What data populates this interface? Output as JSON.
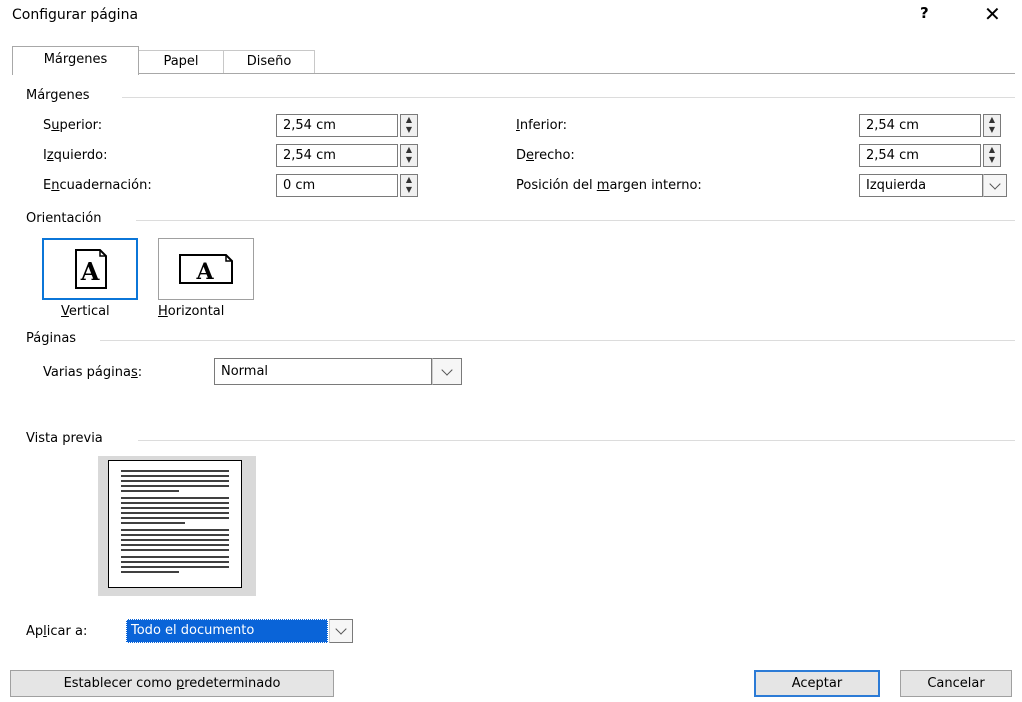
{
  "window": {
    "title": "Configurar página",
    "help_label": "?",
    "close_label": "✕"
  },
  "tabs": [
    {
      "label": "Márgenes",
      "active": true
    },
    {
      "label": "Papel",
      "active": false
    },
    {
      "label": "Diseño",
      "active": false
    }
  ],
  "margins": {
    "section_label": "Márgenes",
    "superior": {
      "label_pre": "S",
      "label_acc": "u",
      "label_post": "perior:",
      "value": "2,54 cm"
    },
    "izquierdo": {
      "label_pre": "I",
      "label_acc": "z",
      "label_post": "quierdo:",
      "value": "2,54 cm"
    },
    "encuadernacion": {
      "label_pre": "E",
      "label_acc": "n",
      "label_post": "cuadernación:",
      "value": "0 cm"
    },
    "inferior": {
      "label_pre": "",
      "label_acc": "I",
      "label_post": "nferior:",
      "value": "2,54 cm"
    },
    "derecho": {
      "label_pre": "D",
      "label_acc": "e",
      "label_post": "recho:",
      "value": "2,54 cm"
    },
    "posicion": {
      "label_pre": "Posición del ",
      "label_acc": "m",
      "label_post": "argen interno:",
      "value": "Izquierda"
    }
  },
  "orientation": {
    "section_label": "Orientación",
    "vertical": {
      "label_acc": "V",
      "label_post": "ertical",
      "glyph": "A"
    },
    "horizontal": {
      "label_acc": "H",
      "label_post": "orizontal",
      "glyph": "A"
    }
  },
  "pages": {
    "section_label": "Páginas",
    "multiple": {
      "label_pre": "Varias página",
      "label_acc": "s",
      "label_post": ":",
      "value": "Normal"
    }
  },
  "preview": {
    "section_label": "Vista previa"
  },
  "apply": {
    "label_pre": "Ap",
    "label_acc": "l",
    "label_post": "icar a:",
    "value": "Todo el documento"
  },
  "buttons": {
    "default_pre": "Establecer como ",
    "default_acc": "p",
    "default_post": "redeterminado",
    "ok": "Aceptar",
    "cancel": "Cancelar"
  },
  "icons": {
    "spin": "spin-updown-icon",
    "dropdown": "chevron-down-icon",
    "close": "close-icon",
    "help": "help-icon"
  },
  "colors": {
    "accent": "#0b76d8",
    "selection": "#0a64d8"
  }
}
